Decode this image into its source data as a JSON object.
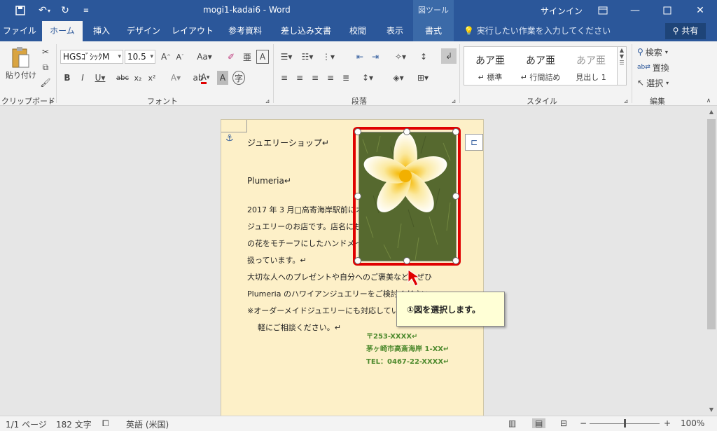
{
  "titlebar": {
    "title": "mogi1-kadai6 - Word",
    "context_label": "図ツール",
    "signin": "サインイン"
  },
  "tabs": {
    "file": "ファイル",
    "home": "ホーム",
    "insert": "挿入",
    "design": "デザイン",
    "layout": "レイアウト",
    "references": "参考資料",
    "mailings": "差し込み文書",
    "review": "校閲",
    "view": "表示",
    "format": "書式",
    "tellme": "実行したい作業を入力してください",
    "share": "共有"
  },
  "ribbon": {
    "paste": "貼り付け",
    "font_name": "HGSｺﾞｼｯｸM",
    "font_size": "10.5",
    "group_clipboard": "クリップボード",
    "group_font": "フォント",
    "group_paragraph": "段落",
    "group_styles": "スタイル",
    "group_editing": "編集",
    "styles": [
      {
        "preview": "あア亜",
        "name": "↵ 標準"
      },
      {
        "preview": "あア亜",
        "name": "↵ 行間詰め"
      },
      {
        "preview": "あア亜",
        "name": "見出し 1"
      }
    ],
    "find": "検索",
    "replace": "置換",
    "select": "選択"
  },
  "document": {
    "line1": "ジュエリーショップ↵",
    "line2": "Plumeria↵",
    "line3": "2017 年 3 月□高寄海岸駅前にオープンしたハワイアン",
    "line4": "ジュエリーのお店です。店名にもなっているプルメリア",
    "line5": "の花をモチーフにしたハンドメイドのアクセサリーを",
    "line6": "扱っています。↵",
    "line7": "大切な人へのプレゼントや自分へのご褒美などにぜひ",
    "line8": "Plumeria のハワイアンジュエリーをご検討ください。↵",
    "line9": "※オーダーメイドジュエリーにも対応していますので気",
    "line10": "軽にご相談ください。↵",
    "addr1": "〒253-XXXX↵",
    "addr2": "茅ヶ崎市高斎海岸 1-XX↵",
    "addr3": "TEL：0467-22-XXXX↵"
  },
  "callout": "①図を選択します。",
  "statusbar": {
    "page": "1/1 ページ",
    "words": "182 文字",
    "language": "英語 (米国)",
    "zoom": "100%"
  },
  "colors": {
    "accent": "#2b579a",
    "selection": "#e00000",
    "page_bg": "#fdf0c8",
    "address_text": "#4e8a2e"
  }
}
